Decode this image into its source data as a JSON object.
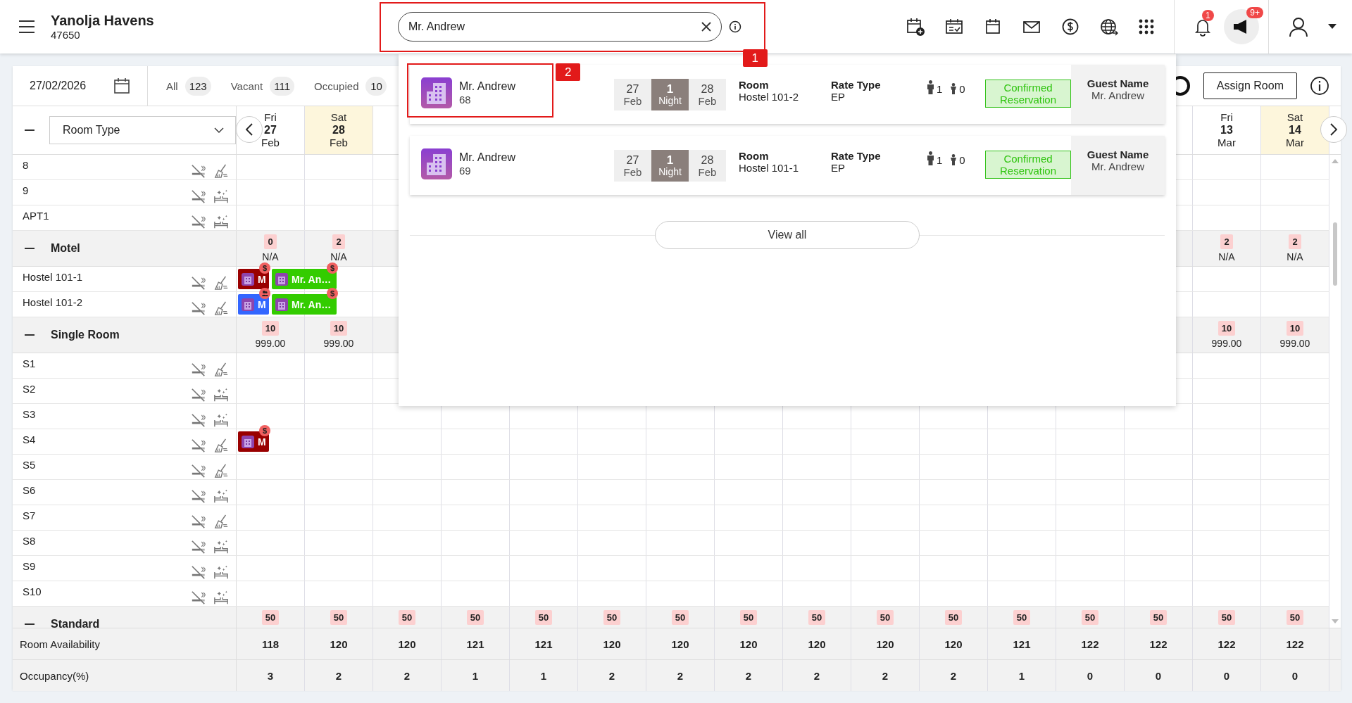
{
  "header": {
    "title": "Yanolja Havens",
    "subtitle": "47650",
    "search": {
      "value": "Mr. Andrew",
      "callout": "1"
    },
    "notifications": {
      "badge": "1"
    },
    "announcements": {
      "badge": "9+"
    }
  },
  "toolbar": {
    "date": "27/02/2026",
    "filters": [
      {
        "label": "All",
        "count": "123"
      },
      {
        "label": "Vacant",
        "count": "111"
      },
      {
        "label": "Occupied",
        "count": "10"
      }
    ],
    "assign_button": "Assign Room"
  },
  "grid": {
    "room_type": "Room Type",
    "days_start": [
      {
        "weekday": "Fri",
        "day": "27",
        "month": "Feb",
        "weekend": false
      },
      {
        "weekday": "Sat",
        "day": "28",
        "month": "Feb",
        "weekend": true
      }
    ],
    "days_end": [
      {
        "weekday": "Fri",
        "day": "13",
        "month": "Mar",
        "weekend": false
      },
      {
        "weekday": "Sat",
        "day": "14",
        "month": "Mar",
        "weekend": true
      }
    ],
    "rows": [
      {
        "kind": "room",
        "name": "8",
        "clean": false
      },
      {
        "kind": "room",
        "name": "9",
        "clean": true
      },
      {
        "kind": "room",
        "name": "APT1",
        "clean": true
      },
      {
        "kind": "group",
        "name": "Motel",
        "expanded": true,
        "cells_start": [
          {
            "count": "0",
            "value": "N/A"
          },
          {
            "count": "2",
            "value": "N/A"
          }
        ],
        "cells_end": [
          {
            "count": "2",
            "value": "N/A"
          },
          {
            "count": "2",
            "value": "N/A"
          }
        ]
      },
      {
        "kind": "room",
        "name": "Hostel 101-1",
        "clean": false,
        "bookings": [
          {
            "kind": "short",
            "text": "M",
            "color": "#990000",
            "badge_text": "$"
          },
          {
            "kind": "long",
            "text": "Mr. An…",
            "color": "#33cc00",
            "badge_text": "$"
          }
        ]
      },
      {
        "kind": "room",
        "name": "Hostel 101-2",
        "clean": false,
        "bookings": [
          {
            "kind": "short",
            "text": "M",
            "color": "#3366ff",
            "guests_badge": true
          },
          {
            "kind": "long",
            "text": "Mr. An…",
            "color": "#33cc00",
            "badge_text": "$"
          }
        ]
      },
      {
        "kind": "group",
        "name": "Single Room",
        "expanded": true,
        "cells_start": [
          {
            "count": "10",
            "value": "999.00"
          },
          {
            "count": "10",
            "value": "999.00"
          }
        ],
        "cells_end": [
          {
            "count": "10",
            "value": "999.00"
          },
          {
            "count": "10",
            "value": "999.00"
          }
        ]
      },
      {
        "kind": "room",
        "name": "S1",
        "clean": false
      },
      {
        "kind": "room",
        "name": "S2",
        "clean": true
      },
      {
        "kind": "room",
        "name": "S3",
        "clean": true
      },
      {
        "kind": "room",
        "name": "S4",
        "clean": false,
        "bookings": [
          {
            "kind": "short",
            "text": "M",
            "color": "#990000",
            "badge_text": "$"
          }
        ]
      },
      {
        "kind": "room",
        "name": "S5",
        "clean": false
      },
      {
        "kind": "room",
        "name": "S6",
        "clean": true
      },
      {
        "kind": "room",
        "name": "S7",
        "clean": false
      },
      {
        "kind": "room",
        "name": "S8",
        "clean": true
      },
      {
        "kind": "room",
        "name": "S9",
        "clean": true
      },
      {
        "kind": "room",
        "name": "S10",
        "clean": true
      },
      {
        "kind": "group",
        "name": "Standard",
        "expanded": true,
        "cells": [
          {
            "count": "50"
          },
          {
            "count": "50"
          },
          {
            "count": "50"
          },
          {
            "count": "50"
          },
          {
            "count": "50"
          },
          {
            "count": "50"
          },
          {
            "count": "50"
          },
          {
            "count": "50"
          },
          {
            "count": "50"
          },
          {
            "count": "50"
          },
          {
            "count": "50"
          },
          {
            "count": "50"
          },
          {
            "count": "50"
          },
          {
            "count": "50"
          },
          {
            "count": "50"
          },
          {
            "count": "50"
          }
        ]
      }
    ],
    "footer": [
      {
        "label": "Room Availability",
        "values": [
          "118",
          "120",
          "120",
          "121",
          "121",
          "120",
          "120",
          "120",
          "120",
          "120",
          "120",
          "121",
          "122",
          "122",
          "122",
          "122"
        ]
      },
      {
        "label": "Occupancy(%)",
        "values": [
          "3",
          "2",
          "2",
          "1",
          "1",
          "2",
          "2",
          "2",
          "2",
          "2",
          "2",
          "1",
          "0",
          "0",
          "0",
          "0"
        ]
      }
    ]
  },
  "search_results": {
    "items": [
      {
        "name": "Mr. Andrew",
        "number": "68",
        "from": {
          "day": "27",
          "month": "Feb"
        },
        "nights": {
          "count": "1",
          "label": "Night"
        },
        "to": {
          "day": "28",
          "month": "Feb"
        },
        "room": {
          "label": "Room",
          "value": "Hostel 101-2"
        },
        "rate": {
          "label": "Rate Type",
          "value": "EP"
        },
        "adults": "1",
        "children": "0",
        "status": "Confirmed Reservation",
        "guest": {
          "label": "Guest Name",
          "value": "Mr. Andrew"
        },
        "callout": "2"
      },
      {
        "name": "Mr. Andrew",
        "number": "69",
        "from": {
          "day": "27",
          "month": "Feb"
        },
        "nights": {
          "count": "1",
          "label": "Night"
        },
        "to": {
          "day": "28",
          "month": "Feb"
        },
        "room": {
          "label": "Room",
          "value": "Hostel 101-1"
        },
        "rate": {
          "label": "Rate Type",
          "value": "EP"
        },
        "adults": "1",
        "children": "0",
        "status": "Confirmed Reservation",
        "guest": {
          "label": "Guest Name",
          "value": "Mr. Andrew"
        }
      }
    ],
    "view_all": "View all"
  }
}
